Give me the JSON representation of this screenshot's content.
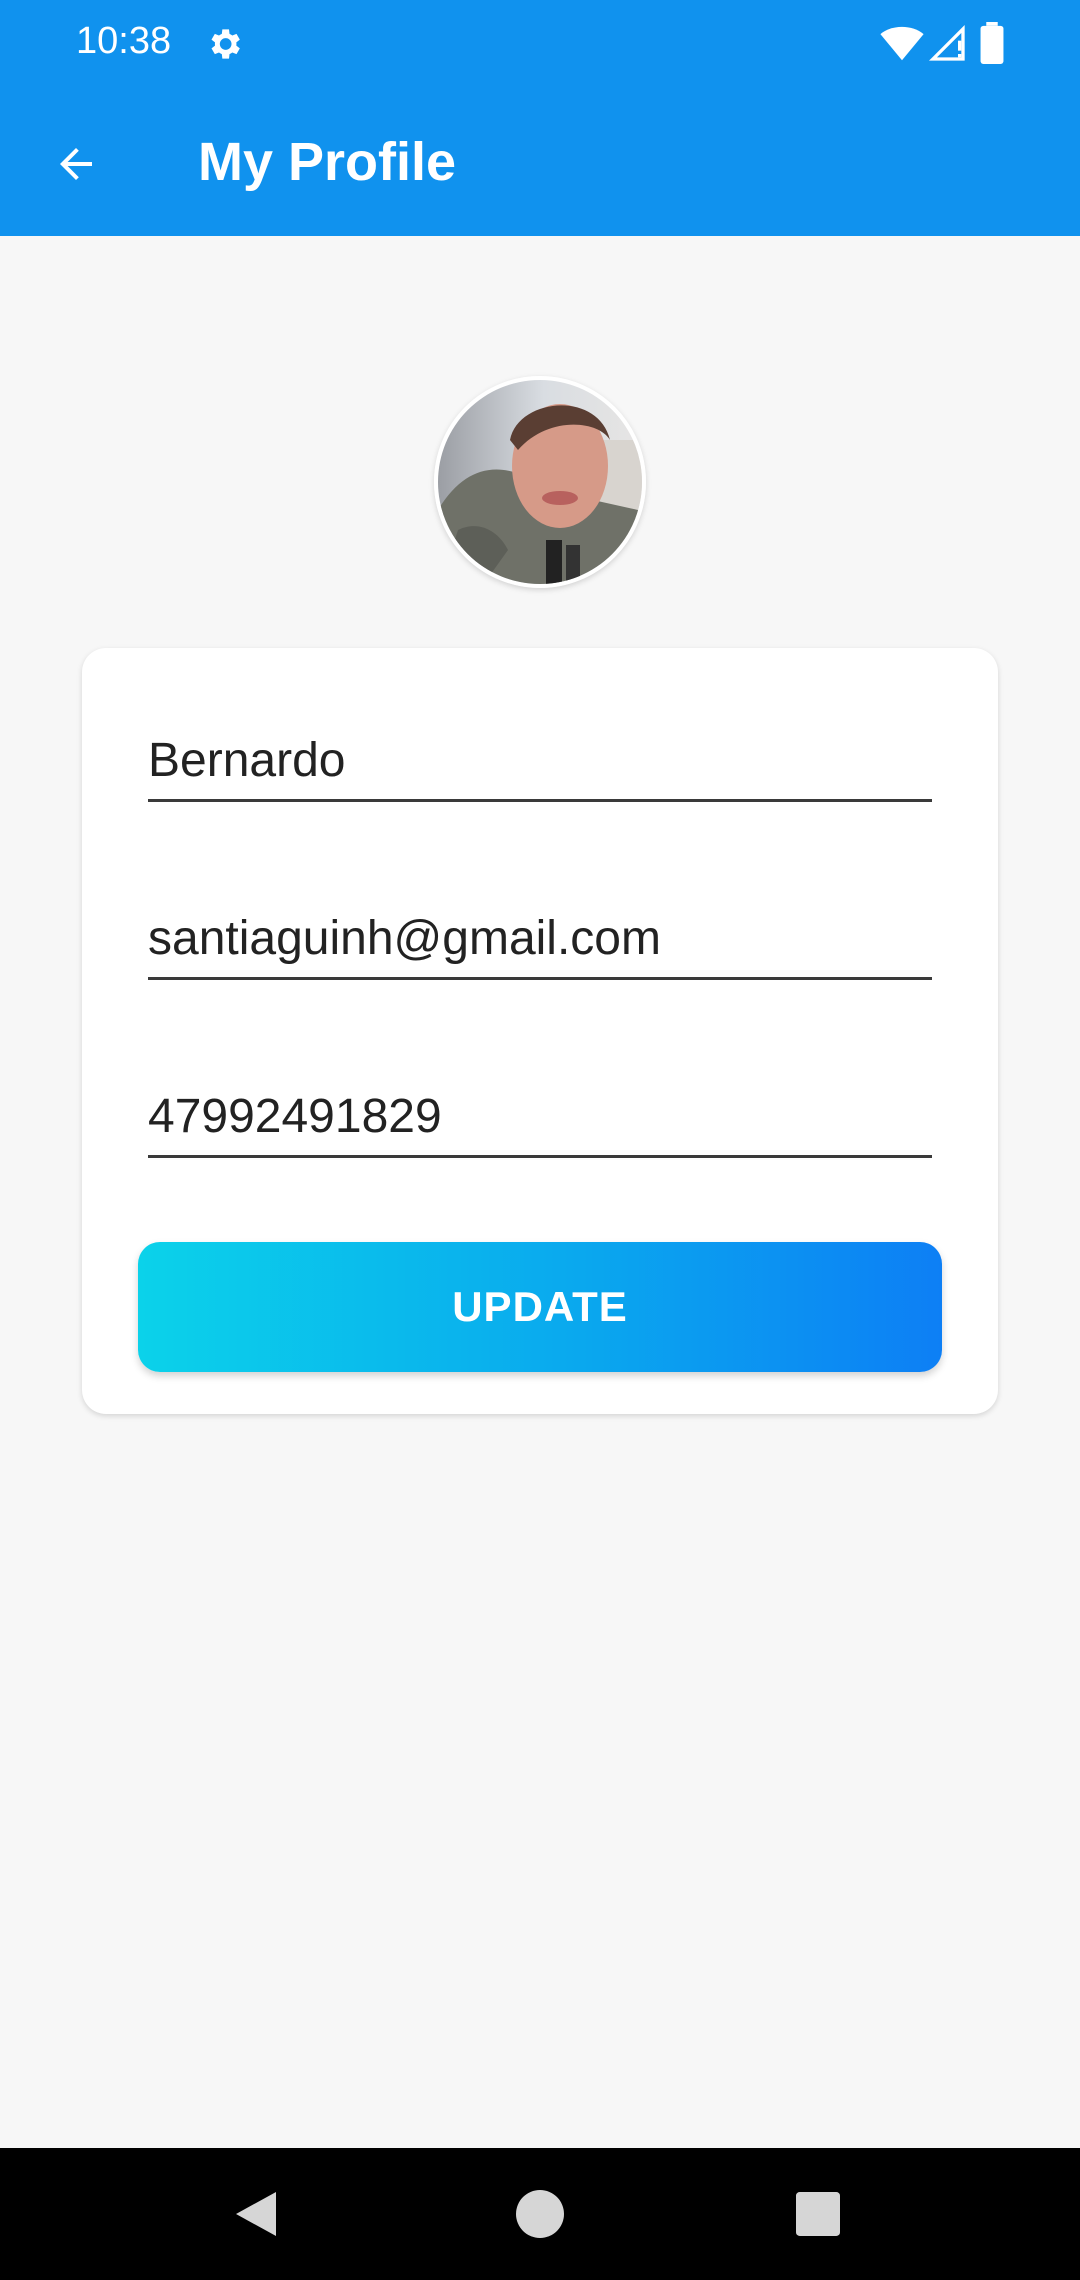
{
  "status_bar": {
    "time": "10:38",
    "icons": [
      "gear-icon",
      "wifi-icon",
      "signal-icon",
      "battery-icon"
    ]
  },
  "app_bar": {
    "title": "My Profile",
    "back_icon": "arrow-back-icon",
    "color": "#1092ee"
  },
  "profile": {
    "avatar": "user-photo",
    "name": "Bernardo",
    "email": "santiaguinh@gmail.com",
    "phone": "47992491829"
  },
  "actions": {
    "update_label": "UPDATE",
    "gradient_start": "#0bd2ea",
    "gradient_end": "#0d7ff5"
  },
  "nav_bar": {
    "icons": [
      "nav-back-icon",
      "nav-home-icon",
      "nav-recents-icon"
    ]
  }
}
